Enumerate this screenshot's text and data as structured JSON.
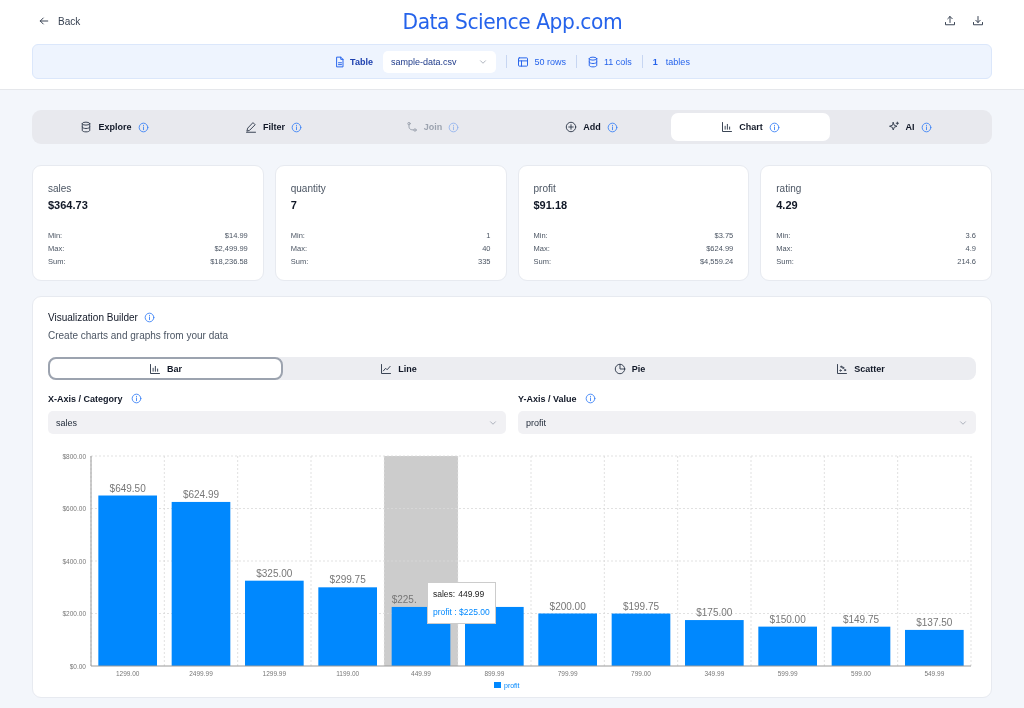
{
  "header": {
    "back": "Back",
    "title": "Data Science App.com"
  },
  "source_bar": {
    "table_label": "Table",
    "file": "sample-data.csv",
    "rows": "50 rows",
    "cols": "11 cols",
    "tables_count": "1",
    "tables_label": "tables"
  },
  "tabs": [
    {
      "label": "Explore",
      "selected": false,
      "disabled": false
    },
    {
      "label": "Filter",
      "selected": false,
      "disabled": false
    },
    {
      "label": "Join",
      "selected": false,
      "disabled": true
    },
    {
      "label": "Add",
      "selected": false,
      "disabled": false
    },
    {
      "label": "Chart",
      "selected": true,
      "disabled": false
    },
    {
      "label": "AI",
      "selected": false,
      "disabled": false
    }
  ],
  "stats": [
    {
      "name": "sales",
      "value": "$364.73",
      "rows": [
        {
          "label": "Min:",
          "value": "$14.99"
        },
        {
          "label": "Max:",
          "value": "$2,499.99"
        },
        {
          "label": "Sum:",
          "value": "$18,236.58"
        }
      ]
    },
    {
      "name": "quantity",
      "value": "7",
      "rows": [
        {
          "label": "Min:",
          "value": "1"
        },
        {
          "label": "Max:",
          "value": "40"
        },
        {
          "label": "Sum:",
          "value": "335"
        }
      ]
    },
    {
      "name": "profit",
      "value": "$91.18",
      "rows": [
        {
          "label": "Min:",
          "value": "$3.75"
        },
        {
          "label": "Max:",
          "value": "$624.99"
        },
        {
          "label": "Sum:",
          "value": "$4,559.24"
        }
      ]
    },
    {
      "name": "rating",
      "value": "4.29",
      "rows": [
        {
          "label": "Min:",
          "value": "3.6"
        },
        {
          "label": "Max:",
          "value": "4.9"
        },
        {
          "label": "Sum:",
          "value": "214.6"
        }
      ]
    }
  ],
  "builder": {
    "title": "Visualization Builder",
    "subtitle": "Create charts and graphs from your data",
    "chart_types": [
      {
        "label": "Bar",
        "selected": true
      },
      {
        "label": "Line",
        "selected": false
      },
      {
        "label": "Pie",
        "selected": false
      },
      {
        "label": "Scatter",
        "selected": false
      }
    ],
    "x_axis": {
      "label": "X-Axis / Category",
      "value": "sales"
    },
    "y_axis": {
      "label": "Y-Axis / Value",
      "value": "profit"
    },
    "chart_data": {
      "type": "bar",
      "categories": [
        "1299.00",
        "2499.99",
        "1299.99",
        "1199.00",
        "449.99",
        "899.99",
        "799.99",
        "799.00",
        "349.99",
        "599.99",
        "599.00",
        "549.99"
      ],
      "series": [
        {
          "name": "profit",
          "color": "#0088fe",
          "values": [
            649.5,
            624.99,
            325.0,
            299.75,
            225.0,
            225.0,
            200.0,
            199.75,
            175.0,
            150.0,
            149.75,
            137.5
          ]
        }
      ],
      "ylim": [
        0,
        800
      ],
      "yticks": [
        {
          "value": 0,
          "label": "$0.00"
        },
        {
          "value": 200,
          "label": "$200.00"
        },
        {
          "value": 400,
          "label": "$400.00"
        },
        {
          "value": 600,
          "label": "$600.00"
        },
        {
          "value": 800,
          "label": "$800.00"
        }
      ],
      "value_labels": [
        "$649.50",
        "$624.99",
        "$325.00",
        "$299.75",
        "$225.",
        null,
        "$200.00",
        "$199.75",
        "$175.00",
        "$150.00",
        "$149.75",
        "$137.50"
      ],
      "grid": true
    },
    "tooltip": {
      "x_label": "sales:",
      "x_value": "449.99",
      "value": "profit : $225.00"
    }
  }
}
